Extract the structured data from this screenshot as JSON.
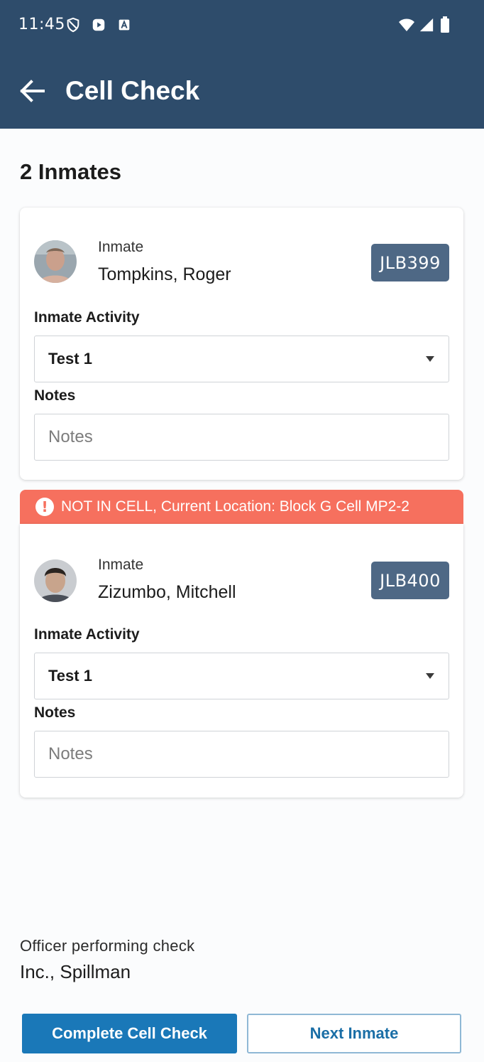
{
  "status_bar": {
    "time": "11:45"
  },
  "header": {
    "title": "Cell Check",
    "back_icon": "arrow-left-icon"
  },
  "inmate_count": "2 Inmates",
  "inmates": [
    {
      "label": "Inmate",
      "name": "Tompkins, Roger",
      "id": "JLB399",
      "activity_label": "Inmate Activity",
      "activity_value": "Test 1",
      "notes_label": "Notes",
      "notes_placeholder": "Notes",
      "notes_value": "",
      "alert": null
    },
    {
      "label": "Inmate",
      "name": "Zizumbo, Mitchell",
      "id": "JLB400",
      "activity_label": "Inmate Activity",
      "activity_value": "Test 1",
      "notes_label": "Notes",
      "notes_placeholder": "Notes",
      "notes_value": "",
      "alert": "NOT IN CELL, Current Location: Block G Cell MP2-2"
    }
  ],
  "officer": {
    "label": "Officer performing check",
    "name": "Inc., Spillman"
  },
  "actions": {
    "complete_label": "Complete Cell Check",
    "next_label": "Next Inmate"
  },
  "colors": {
    "appbar": "#2e4c6b",
    "badge": "#4e6885",
    "alert": "#f6705e",
    "primary": "#1a78b8"
  }
}
